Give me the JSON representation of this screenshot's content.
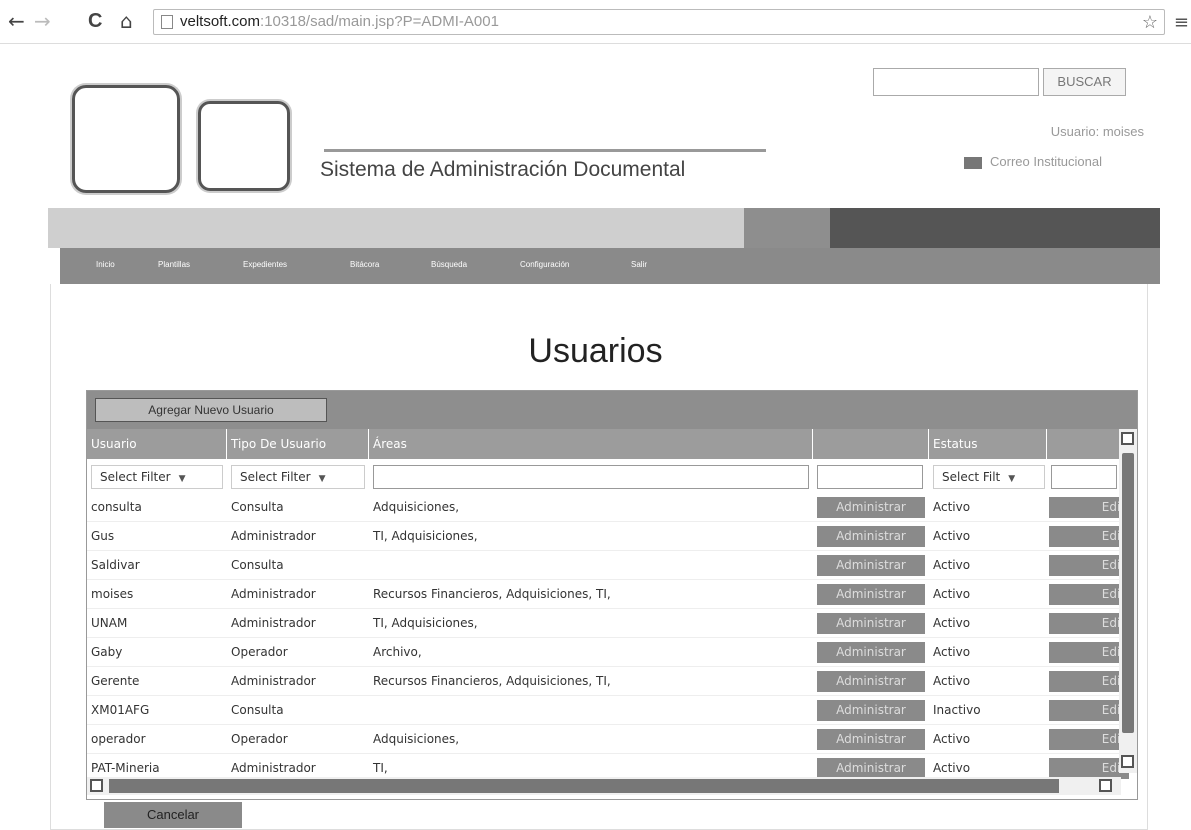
{
  "browser": {
    "back_icon": "←",
    "forward_icon": "→",
    "reload_icon": "C",
    "home_icon": "⌂",
    "url_host": "veltsoft.com",
    "url_rest": ":10318/sad/main.jsp?P=ADMI-A001",
    "bookmark_icon": "☆",
    "menu_icon": "≡"
  },
  "header": {
    "system_title": "Sistema de Administración Documental",
    "search_placeholder": "",
    "search_button": "BUSCAR",
    "user_label": "Usuario: moises",
    "mail_link": "Correo Institucional"
  },
  "nav": {
    "items": [
      "Inicio",
      "Plantillas",
      "Expedientes",
      "Bitácora",
      "Búsqueda",
      "Configuración",
      "Salir"
    ]
  },
  "page": {
    "title": "Usuarios",
    "add_button": "Agregar Nuevo Usuario",
    "cancel_button": "Cancelar"
  },
  "grid": {
    "columns": [
      "Usuario",
      "Tipo De Usuario",
      "Áreas",
      "",
      "Estatus",
      ""
    ],
    "filters": {
      "usuario": "Select Filter",
      "tipo": "Select Filter",
      "areas": "",
      "blank": "",
      "estatus": "Select Filt",
      "last": ""
    },
    "admin_label": "Administrar",
    "edit_label": "Edit",
    "rows": [
      {
        "usuario": "consulta",
        "tipo": "Consulta",
        "areas": "Adquisiciones,",
        "estatus": "Activo"
      },
      {
        "usuario": "Gus",
        "tipo": "Administrador",
        "areas": "TI, Adquisiciones,",
        "estatus": "Activo"
      },
      {
        "usuario": "Saldivar",
        "tipo": "Consulta",
        "areas": "",
        "estatus": "Activo"
      },
      {
        "usuario": "moises",
        "tipo": "Administrador",
        "areas": "Recursos Financieros, Adquisiciones, TI,",
        "estatus": "Activo"
      },
      {
        "usuario": "UNAM",
        "tipo": "Administrador",
        "areas": "TI, Adquisiciones,",
        "estatus": "Activo"
      },
      {
        "usuario": "Gaby",
        "tipo": "Operador",
        "areas": "Archivo,",
        "estatus": "Activo"
      },
      {
        "usuario": "Gerente",
        "tipo": "Administrador",
        "areas": "Recursos Financieros, Adquisiciones, TI,",
        "estatus": "Activo"
      },
      {
        "usuario": "XM01AFG",
        "tipo": "Consulta",
        "areas": "",
        "estatus": "Inactivo"
      },
      {
        "usuario": "operador",
        "tipo": "Operador",
        "areas": "Adquisiciones,",
        "estatus": "Activo"
      },
      {
        "usuario": "PAT-Mineria",
        "tipo": "Administrador",
        "areas": "TI,",
        "estatus": "Activo"
      }
    ]
  }
}
